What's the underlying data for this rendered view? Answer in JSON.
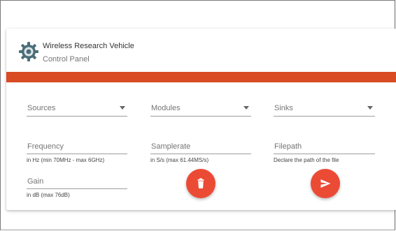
{
  "header": {
    "title": "Wireless Research Vehicle",
    "subtitle": "Control Panel",
    "icon": "gear-icon"
  },
  "colors": {
    "accent": "#d84b23",
    "fab": "#eb4b35"
  },
  "selects": [
    {
      "label": "Sources"
    },
    {
      "label": "Modules"
    },
    {
      "label": "Sinks"
    }
  ],
  "fields": {
    "frequency": {
      "label": "Frequency",
      "hint": "in Hz (min 70MHz - max 6GHz)"
    },
    "samplerate": {
      "label": "Samplerate",
      "hint": "in S/s (max 61.44MS/s)"
    },
    "filepath": {
      "label": "Filepath",
      "hint": "Declare the path of the file"
    },
    "gain": {
      "label": "Gain",
      "hint": "in dB (max 76dB)"
    }
  },
  "actions": {
    "delete_icon": "trash-icon",
    "send_icon": "send-icon"
  }
}
